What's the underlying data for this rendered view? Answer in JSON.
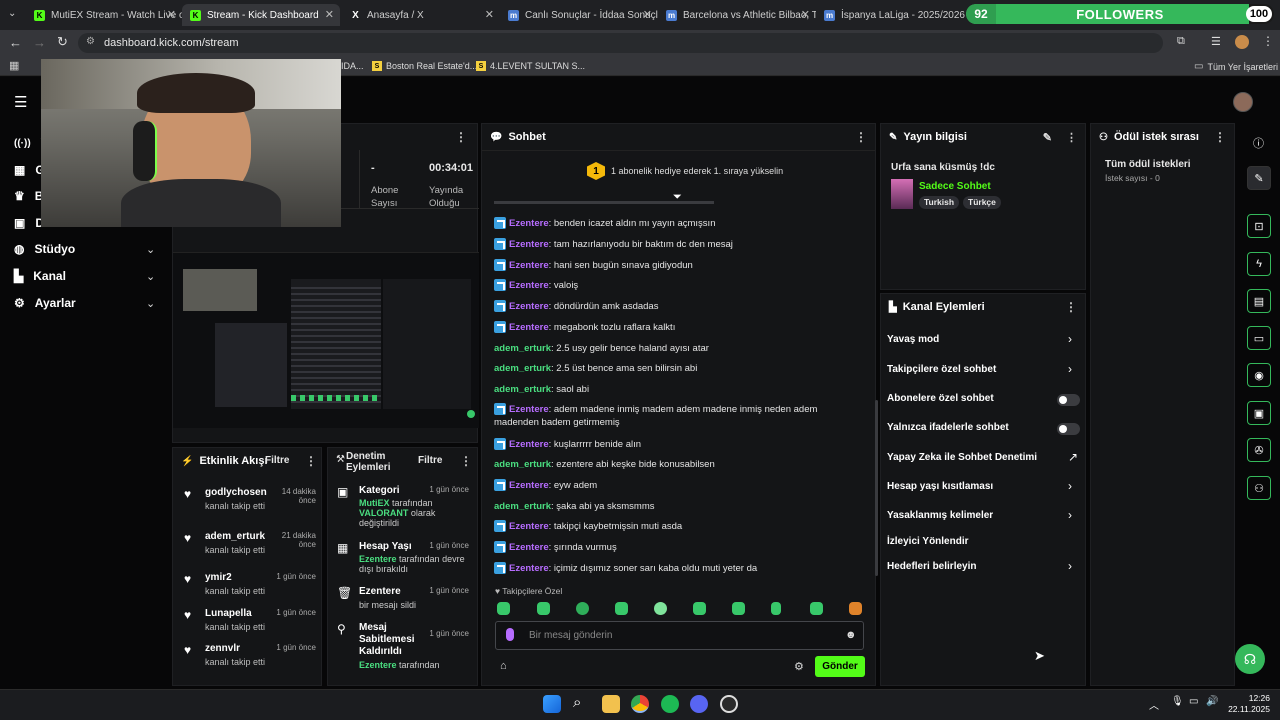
{
  "browser": {
    "tabs": [
      {
        "label": "MutiEX Stream - Watch Live on",
        "fav": "K",
        "favcolor": "#53fc18"
      },
      {
        "label": "Stream - Kick Dashboard",
        "fav": "K",
        "favcolor": "#53fc18"
      },
      {
        "label": "Anasayfa / X",
        "fav": "X",
        "favcolor": "#ffffff"
      },
      {
        "label": "Canlı Sonuçlar - İddaa Sonuçla",
        "fav": "m",
        "favcolor": "#4a7bd0"
      },
      {
        "label": "Barcelona vs Athletic Bilbao, Tar",
        "fav": "m",
        "favcolor": "#4a7bd0"
      },
      {
        "label": "İspanya LaLiga - 2025/2026 - Pu",
        "fav": "m",
        "favcolor": "#4a7bd0"
      }
    ],
    "url": "dashboard.kick.com/stream",
    "bookmarks": [
      {
        "label": "Boston Real Estate'd...",
        "icon": "S"
      },
      {
        "label": "4.LEVENT SULTAN S...",
        "icon": "S"
      }
    ],
    "bookmarks_truncated": "IDA...",
    "all_bookmarks": "Tüm Yer İşaretleri"
  },
  "followers_widget": {
    "current": "92",
    "title": "FOLLOWERS",
    "goal": "100",
    "progress": 0.92
  },
  "sidebar": {
    "items": [
      {
        "label": "Y",
        "icon": "broadcast-icon"
      },
      {
        "label": "G"
      },
      {
        "label": "B"
      },
      {
        "label": "D"
      },
      {
        "label": "Stüdyo"
      },
      {
        "label": "Kanal"
      },
      {
        "label": "Ayarlar"
      }
    ]
  },
  "stats": {
    "viewers_value": "-",
    "viewers_label_1": "Abone",
    "viewers_label_2": "Sayısı",
    "uptime_value": "00:34:01",
    "uptime_label_1": "Yayında",
    "uptime_label_2": "Olduğu"
  },
  "activity": {
    "title": "Etkinlik Akışı",
    "filter": "Filtre",
    "items": [
      {
        "name": "godlychosen",
        "action": "kanalı takip etti",
        "time": "14 dakika önce"
      },
      {
        "name": "adem_erturk",
        "action": "kanalı takip etti",
        "time": "21 dakika önce"
      },
      {
        "name": "ymir2",
        "action": "kanalı takip etti",
        "time": "1 gün önce"
      },
      {
        "name": "Lunapella",
        "action": "kanalı takip etti",
        "time": "1 gün önce"
      },
      {
        "name": "zennvlr",
        "action": "kanalı takip etti",
        "time": "1 gün önce"
      }
    ]
  },
  "moderation": {
    "title_1": "Denetim",
    "title_2": "Eylemleri",
    "filter": "Filtre",
    "items": [
      {
        "name": "Kategori",
        "time": "1 gün önce",
        "actor": "MutiEX",
        "mid": " tarafından ",
        "value": "VALORANT",
        "tail": " olarak değiştirildi"
      },
      {
        "name": "Hesap Yaşı",
        "time": "1 gün önce",
        "actor": "Ezentere",
        "tail": " tarafından devre dışı bırakıldı"
      },
      {
        "name": "Ezentere",
        "time": "1 gün önce",
        "tail": "bir mesajı sildi"
      },
      {
        "name": "Mesaj Sabitlemesi Kaldırıldı",
        "time": "1 gün önce",
        "actor": "Ezentere",
        "tail": " tarafından"
      }
    ]
  },
  "chat": {
    "title": "Sohbet",
    "gift_count": "1",
    "gift_text": "1 abonelik hediye ederek 1. sıraya yükselin",
    "messages": [
      {
        "user": "Ezentere",
        "badge": true,
        "text": ": benden icazet aldın mı yayın açmışsın"
      },
      {
        "user": "Ezentere",
        "badge": true,
        "text": ": tam hazırlanıyodu bir baktım dc den mesaj"
      },
      {
        "user": "Ezentere",
        "badge": true,
        "text": ": hani sen bugün sınava gidiyodun"
      },
      {
        "user": "Ezentere",
        "badge": true,
        "text": ": valoiş"
      },
      {
        "user": "Ezentere",
        "badge": true,
        "text": ": döndürdün amk asdadas"
      },
      {
        "user": "Ezentere",
        "badge": true,
        "text": ": megabonk tozlu raflara kalktı"
      },
      {
        "user": "adem_erturk",
        "badge": false,
        "text": ": 2.5 usy gelir bence haland ayısı atar"
      },
      {
        "user": "adem_erturk",
        "badge": false,
        "text": ": 2.5 üst bence ama sen bilirsin abi"
      },
      {
        "user": "adem_erturk",
        "badge": false,
        "text": ": saol abi"
      },
      {
        "user": "Ezentere",
        "badge": true,
        "text": ": adem madene inmiş madem adem madene inmiş neden adem madenden badem getirmemiş"
      },
      {
        "user": "Ezentere",
        "badge": true,
        "text": ": kuşlarrrrr benide alın"
      },
      {
        "user": "adem_erturk",
        "badge": false,
        "text": ": ezentere abi keşke bide konusabilsen"
      },
      {
        "user": "Ezentere",
        "badge": true,
        "text": ": eyw adem"
      },
      {
        "user": "adem_erturk",
        "badge": false,
        "text": ": şaka abi ya sksmsmms"
      },
      {
        "user": "Ezentere",
        "badge": true,
        "text": ": takipçi kaybetmişsin muti asda"
      },
      {
        "user": "Ezentere",
        "badge": true,
        "text": ": şırında vurmuş"
      },
      {
        "user": "Ezentere",
        "badge": true,
        "text": ": içimiz dışımız soner sarı kaba oldu muti yeter da"
      }
    ],
    "followers_only": "Takipçilere Özel",
    "placeholder": "Bir mesaj gönderin",
    "send": "Gönder"
  },
  "stream_info": {
    "title": "Yayın bilgisi",
    "stream_title": "Urfa sana küsmüş !dc",
    "category": "Sadece Sohbet",
    "tags": [
      "Turkish",
      "Türkçe"
    ]
  },
  "channel_actions": {
    "title": "Kanal Eylemleri",
    "items": [
      {
        "label": "Yavaş mod",
        "ctrl": "chevron"
      },
      {
        "label": "Takipçilere özel sohbet",
        "ctrl": "chevron"
      },
      {
        "label": "Abonelere özel sohbet",
        "ctrl": "toggle"
      },
      {
        "label": "Yalnızca ifadelerle sohbet",
        "ctrl": "toggle"
      },
      {
        "label": "Yapay Zeka ile Sohbet Denetimi",
        "ctrl": "external"
      },
      {
        "label": "Hesap yaşı kısıtlaması",
        "ctrl": "chevron"
      },
      {
        "label": "Yasaklanmış kelimeler",
        "ctrl": "chevron"
      },
      {
        "label": "İzleyici Yönlendir",
        "ctrl": "none"
      },
      {
        "label": "Hedefleri belirleyin",
        "ctrl": "chevron"
      }
    ]
  },
  "rewards": {
    "title": "Ödül istek sırası",
    "all": "Tüm ödül istekleri",
    "count": "İstek sayısı - 0"
  },
  "taskbar": {
    "time": "12:26",
    "date": "22.11.2025"
  },
  "colors": {
    "accent": "#53fc18",
    "brand_green": "#35b85b",
    "purple_user": "#b76dff",
    "green_user": "#4ade80"
  }
}
